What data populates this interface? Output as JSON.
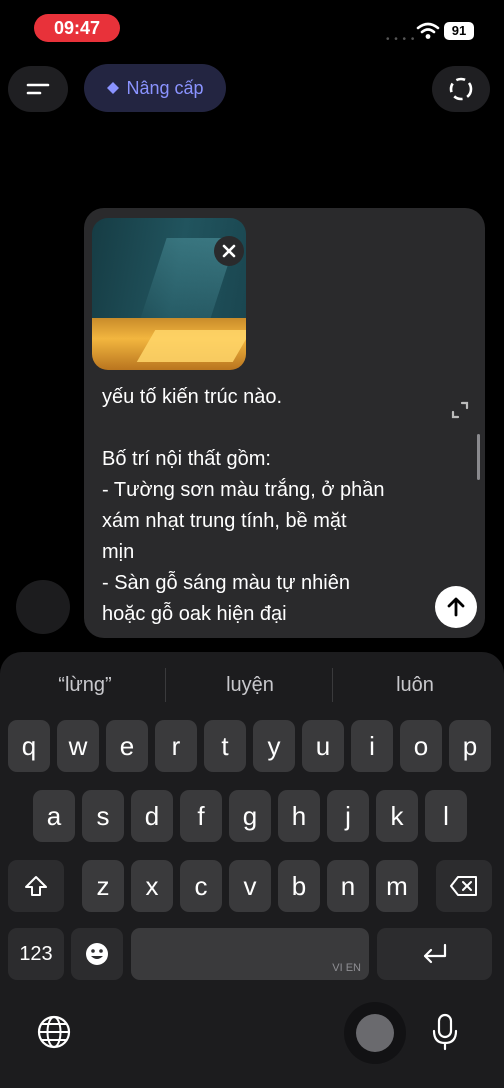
{
  "status_bar": {
    "time": "09:47",
    "battery": "91"
  },
  "top_bar": {
    "upgrade_label": "Nâng cấp"
  },
  "composer": {
    "text_lines": [
      "yếu tố kiến trúc nào.",
      "",
      "Bố trí nội thất gồm:",
      "- Tường sơn màu trắng, ở phần",
      "xám nhạt trung tính, bề mặt",
      "mịn",
      "- Sàn gỗ sáng màu tự nhiên",
      "hoặc gỗ oak hiện đại"
    ]
  },
  "keyboard": {
    "suggestions": [
      "“lừng”",
      "luyện",
      "luôn"
    ],
    "rows": [
      [
        "q",
        "w",
        "e",
        "r",
        "t",
        "y",
        "u",
        "i",
        "o",
        "p"
      ],
      [
        "a",
        "s",
        "d",
        "f",
        "g",
        "h",
        "j",
        "k",
        "l"
      ],
      [
        "z",
        "x",
        "c",
        "v",
        "b",
        "n",
        "m"
      ]
    ],
    "numbers_label": "123",
    "space_lang": "VI EN"
  },
  "colors": {
    "accent": "#8a93ff",
    "time_badge": "#e8323a",
    "background": "#000000"
  },
  "icons": [
    "wifi-icon",
    "menu-icon",
    "diamond-icon",
    "new-chat-icon",
    "close-icon",
    "expand-icon",
    "send-arrow-icon",
    "shift-icon",
    "backspace-icon",
    "emoji-icon",
    "return-icon",
    "globe-icon",
    "mic-icon"
  ]
}
